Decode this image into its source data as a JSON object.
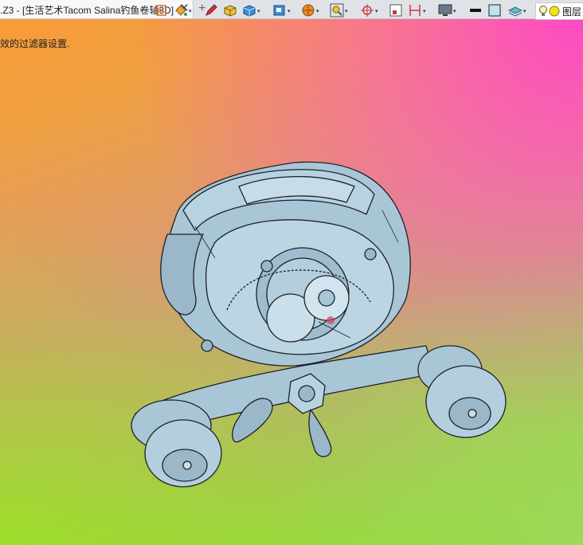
{
  "window": {
    "tab_title": ".Z3 - [生活艺术Tacom Salina钓鱼卷轴3D]",
    "close_glyph": "✕",
    "new_tab_glyph": "+"
  },
  "viewport": {
    "status_message": "效的过滤器设置."
  },
  "toolbar": {
    "dropdown_glyph": "▾",
    "layer_label": "图层",
    "icons": [
      "home-arrow-icon",
      "paint-bucket-icon",
      "pen-icon",
      "box-yellow-icon",
      "cube-blue-icon",
      "cube-view-icon",
      "sphere-icon",
      "zoom-fit-icon",
      "axis-pivot-icon",
      "frame-icon",
      "dimension-icon",
      "monitor-icon",
      "line-thickness-icon",
      "color-swatch-icon",
      "layer-stack-icon",
      "bulb-icon"
    ],
    "colors": {
      "accent_orange": "#f08a20",
      "accent_blue": "#3a8fd8",
      "swatch": "#bfe2f0"
    }
  },
  "model": {
    "name": "fishing-reel-3d-model",
    "colors": {
      "body": "#a9c6d6",
      "shadow": "#7f9db0",
      "edge": "#1c2228"
    }
  }
}
